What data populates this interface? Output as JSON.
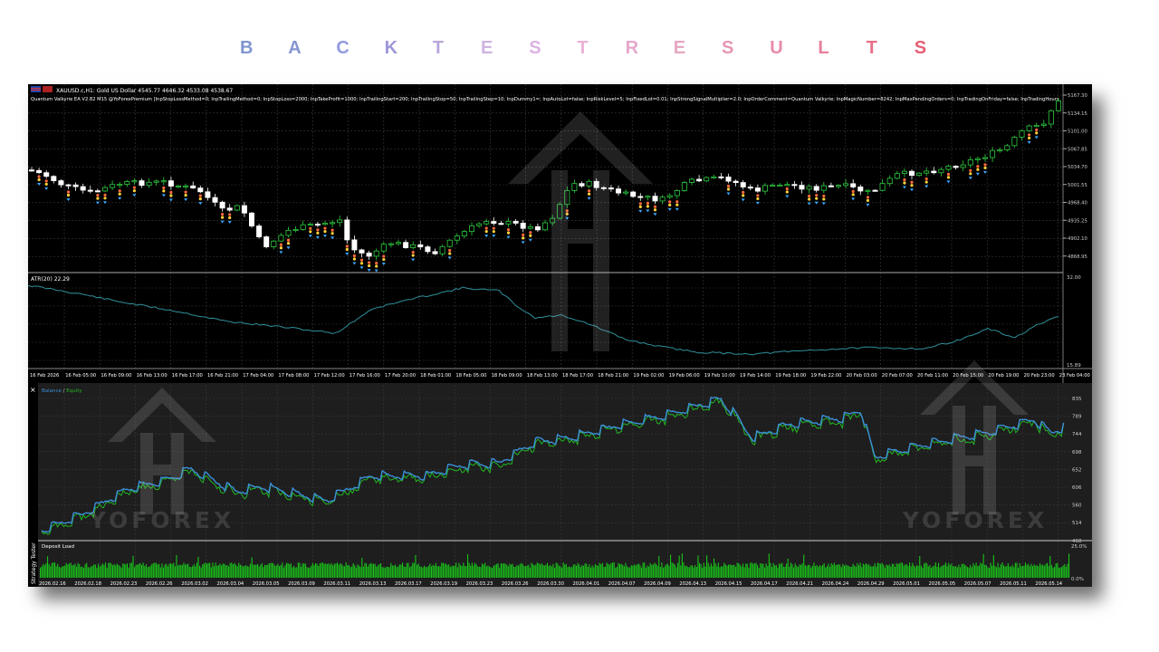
{
  "page_title": {
    "letters": [
      "B",
      "A",
      "C",
      "K",
      "T",
      "E",
      "S",
      "T",
      "R",
      "E",
      "S",
      "U",
      "L",
      "T",
      "S"
    ],
    "colors": [
      "#7f97cf",
      "#8796d2",
      "#939be0",
      "#9d98d8",
      "#b9a7dc",
      "#cfb4e2",
      "#ddb3e4",
      "#eab2d4",
      "#e6a7cc",
      "#e7a7c2",
      "#e896b6",
      "#e88aaa",
      "#e67f9a",
      "#e86f89",
      "#e75f75"
    ]
  },
  "chart_window": {
    "header": "XAUUSD.c,H1:  Gold US Dollar  4545.77 4646.32 4533.08 4538.67",
    "ea_params": "Quantum Valkyrie EA V2.82 M15 @YoForexPremium  [InpStopLossMethod=0; InpTrailingMethod=0; InpStopLoss=2000; InpTakeProfit=1000; InpTrailingStart=200; InpTrailingStop=50; InpTrailingStep=10; InpDummy1=; InpAutoLot=false; InpRiskLevel=5; InpFixedLot=0.01; InpStrongSignalMultiplier=2.0; InpOrderComment=Quantum Valkyrie; InpMagicNumber=8242; InpMaxPendingOrders=0; InpTradingOnFriday=false; InpTradingHours",
    "price_labels": [
      "5167.30",
      "5134.15",
      "5101.00",
      "5067.85",
      "5034.70",
      "5001.55",
      "4968.40",
      "4935.25",
      "4902.10",
      "4868.95"
    ],
    "atr_label": "ATR(20) 22.29",
    "atr_scale": [
      "32.00",
      "15.89"
    ],
    "time_labels": [
      "16 Feb 2026",
      "16 Feb 05:00",
      "16 Feb 09:00",
      "16 Feb 13:00",
      "16 Feb 17:00",
      "16 Feb 21:00",
      "17 Feb 04:00",
      "17 Feb 08:00",
      "17 Feb 12:00",
      "17 Feb 16:00",
      "17 Feb 20:00",
      "18 Feb 01:00",
      "18 Feb 05:00",
      "18 Feb 09:00",
      "18 Feb 13:00",
      "18 Feb 17:00",
      "18 Feb 21:00",
      "19 Feb 02:00",
      "19 Feb 06:00",
      "19 Feb 10:00",
      "19 Feb 14:00",
      "19 Feb 18:00",
      "19 Feb 22:00",
      "20 Feb 03:00",
      "20 Feb 07:00",
      "20 Feb 11:00",
      "20 Feb 15:00",
      "20 Feb 19:00",
      "20 Feb 23:00",
      "23 Feb 04:00"
    ]
  },
  "tester_window": {
    "close_glyph": "×",
    "legend_balance": "Balance",
    "legend_sep": " / ",
    "legend_equity": "Equity",
    "balance_scale": [
      "835",
      "789",
      "744",
      "698",
      "652",
      "606",
      "560",
      "514",
      "468"
    ],
    "deposit_label": "Deposit Load",
    "deposit_scale": [
      "25.0%",
      "0.0%"
    ],
    "side_label": "Strategy Tester",
    "date_labels": [
      "2026.02.16",
      "2026.02.18",
      "2026.02.23",
      "2026.02.26",
      "2026.03.02",
      "2026.03.04",
      "2026.03.05",
      "2026.03.09",
      "2026.03.11",
      "2026.03.13",
      "2026.03.17",
      "2026.03.19",
      "2026.03.23",
      "2026.03.26",
      "2026.03.30",
      "2026.04.01",
      "2026.04.07",
      "2026.04.09",
      "2026.04.13",
      "2026.04.15",
      "2026.04.17",
      "2026.04.21",
      "2026.04.24",
      "2026.04.29",
      "2026.05.01",
      "2026.05.05",
      "2026.05.07",
      "2026.05.11",
      "2026.05.14"
    ]
  },
  "watermark": {
    "brand": "YOFOREX",
    "logo_icon": "yoforex-arrow-logo"
  },
  "colors": {
    "background": "#000000",
    "grid": "#3a3a3a",
    "bull_candle": "#2ecc40",
    "bear_candle": "#ffffff",
    "atr_line": "#2f8f9a",
    "balance_line": "#3b8fd8",
    "equity_line": "#22b522",
    "deposit_bars": "#19c219",
    "tester_bg": "#1e1e1e"
  }
}
